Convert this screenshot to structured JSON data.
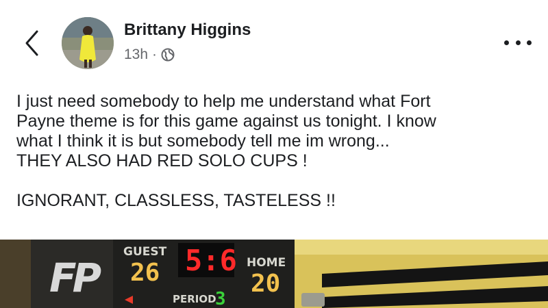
{
  "header": {
    "author_name": "Brittany Higgins",
    "timestamp": "13h",
    "separator": "·",
    "back_icon": "chevron-left-icon",
    "privacy_icon": "globe-icon",
    "more_icon": "more-horizontal-icon"
  },
  "post": {
    "lines": [
      "I just need somebody to help me understand what Fort",
      "Payne theme is for this game against us tonight. I know",
      "what I think it is but somebody tell me im wrong...",
      "THEY ALSO HAD RED SOLO CUPS !",
      "",
      "IGNORANT, CLASSLESS, TASTELESS !!"
    ]
  },
  "photo": {
    "scoreboard": {
      "guest_label": "GUEST",
      "home_label": "HOME",
      "guest_score": "26",
      "home_score": "20",
      "clock": "5:6",
      "period_label": "PERIOD",
      "period_value": "3",
      "logo_text": "FP"
    }
  },
  "colors": {
    "text": "#1c1e21",
    "secondary_text": "#65676b",
    "clock_red": "#ff2a2a",
    "score_amber": "#f2c14e",
    "period_green": "#3ad13a"
  }
}
